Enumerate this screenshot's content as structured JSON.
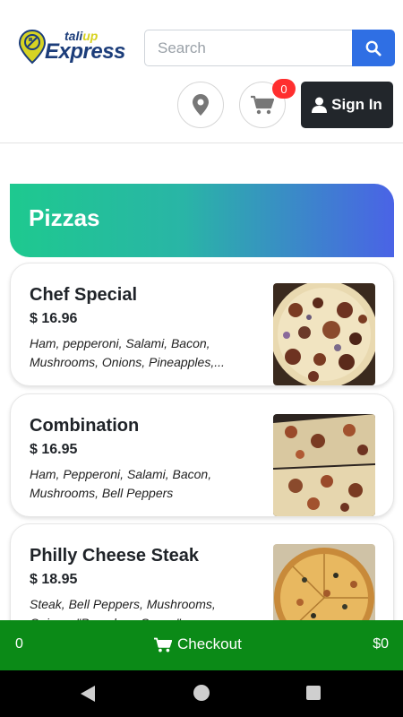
{
  "header": {
    "logo": {
      "small_prefix": "tali",
      "small_suffix": "up",
      "big": "Express"
    },
    "search": {
      "placeholder": "Search",
      "value": ""
    },
    "cart_count": "0",
    "signin_label": "Sign In"
  },
  "category": {
    "title": "Pizzas"
  },
  "items": [
    {
      "name": "Chef Special",
      "price": "$ 16.96",
      "description": "Ham, pepperoni, Salami, Bacon, Mushrooms, Onions, Pineapples,..."
    },
    {
      "name": "Combination",
      "price": "$ 16.95",
      "description": "Ham, Pepperoni, Salami, Bacon, Mushrooms, Bell Peppers"
    },
    {
      "name": "Philly Cheese Steak",
      "price": "$ 18.95",
      "description": "Steak, Bell Peppers, Mushrooms, Onions, \"Provolone Sauce\""
    }
  ],
  "checkout": {
    "count": "0",
    "label": "Checkout",
    "total": "$0"
  },
  "colors": {
    "search_button": "#2f6fe4",
    "signin_button": "#22262b",
    "badge": "#ff2f2f",
    "checkout_bar": "#0b8a17",
    "category_gradient_start": "#1ec98f",
    "category_gradient_end": "#4a63e6"
  },
  "icons": {
    "search": "search-icon",
    "location": "location-pin-icon",
    "cart": "shopping-cart-icon",
    "user": "user-icon",
    "checkout_cart": "shopping-cart-icon",
    "nav_back": "back-triangle-icon",
    "nav_home": "home-circle-icon",
    "nav_recent": "recent-square-icon"
  }
}
